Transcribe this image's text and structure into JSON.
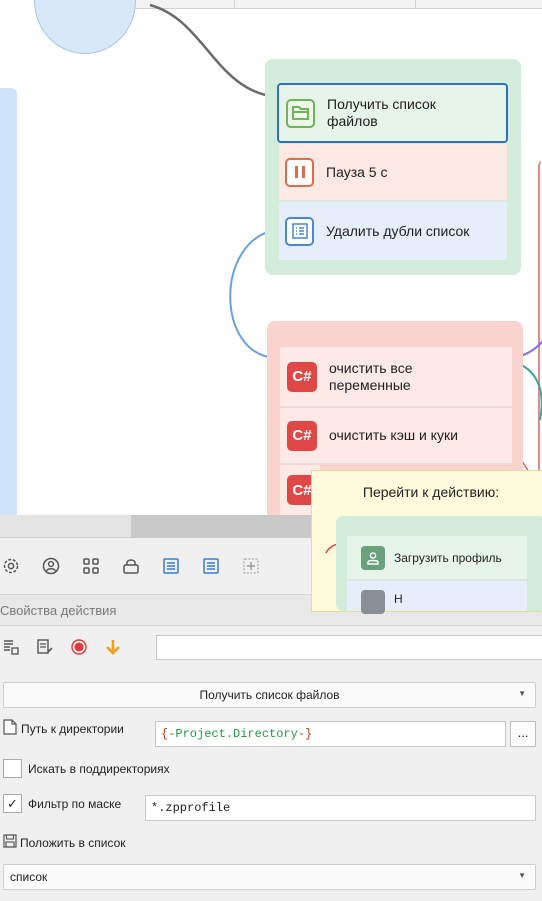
{
  "canvas": {
    "group1": {
      "actions": [
        {
          "label": "Получить список файлов",
          "icon": "folder-icon",
          "color": "#6fb45a"
        },
        {
          "label": "Пауза 5 с",
          "icon": "pause-icon",
          "color": "#e06a4d"
        },
        {
          "label": "Удалить дубли список",
          "icon": "list-icon",
          "color": "#4a87d6"
        }
      ]
    },
    "group2": {
      "actions": [
        {
          "label": "очистить все переменные",
          "icon_text": "C#",
          "color": "#e04848"
        },
        {
          "label": "очистить кэш и куки",
          "icon_text": "C#",
          "color": "#e04848"
        },
        {
          "label": "",
          "icon_text": "C#",
          "color": "#e04848"
        }
      ]
    },
    "goto_popup": {
      "title": "Перейти к действию:",
      "items": [
        {
          "label": "Загрузить профиль",
          "icon": "user-icon"
        },
        {
          "label": "Н",
          "icon": "list-icon"
        }
      ]
    }
  },
  "toolbar_icons": [
    "settings-icon",
    "profile-icon",
    "grid-icon",
    "lock-icon",
    "list-icon",
    "list-icon",
    "add-icon"
  ],
  "panel": {
    "title": "Свойства действия",
    "action_select": "Получить список файлов",
    "directory_label": "Путь к директории",
    "directory_prefix": "{-",
    "directory_var": "Project.Directory",
    "directory_suffix": "-}",
    "browse_button": "...",
    "subdirs_label": "Искать в поддиректориях",
    "subdirs_checked": false,
    "mask_label": "Фильтр по маске",
    "mask_checked": true,
    "mask_value": "*.zpprofile",
    "put_label": "Положить в список",
    "list_select": "список",
    "check_mark": "✓",
    "caret": "▼"
  }
}
